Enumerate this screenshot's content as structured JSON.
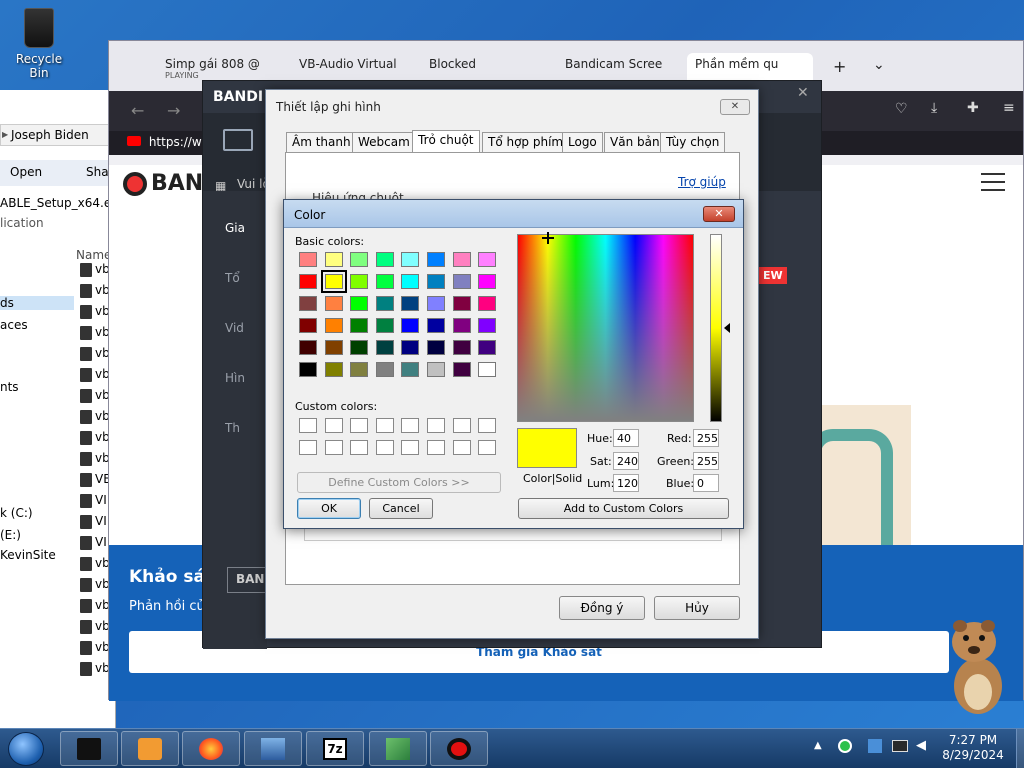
{
  "desktop": {
    "recycle_bin": "Recycle Bin"
  },
  "explorer": {
    "address": "Joseph Biden",
    "address_sep": "▶",
    "open": "Open",
    "share": "Sha",
    "file_title": "ABLE_Setup_x64.ex",
    "file_sub": "lication",
    "nav": [
      "ds",
      "aces",
      "nts",
      "k (C:)",
      "(E:)",
      "KevinSite"
    ],
    "column_name": "Name",
    "file_rows": [
      "vb",
      "vb",
      "vb",
      "vb",
      "vb",
      "vb",
      "vb",
      "vb",
      "vb",
      "vb",
      "VB",
      "VI",
      "VI",
      "VI",
      "vb",
      "vb",
      "vb",
      "vb",
      "vb",
      "vb"
    ]
  },
  "browser": {
    "tabs": [
      {
        "label": "Simp gái 808 @",
        "sub": "PLAYING"
      },
      {
        "label": "VB-Audio Virtual"
      },
      {
        "label": "Blocked"
      },
      {
        "label": "Bandicam Scree"
      },
      {
        "label": "Phần mềm qu"
      }
    ],
    "new_tab": "+",
    "tab_list": "⌄",
    "url": "https://ww",
    "survey_heading": "Khảo sát",
    "survey_text": "Phản hồi củ",
    "survey_button": "Tham gia Khảo sát"
  },
  "bandicam": {
    "logo": "BANDI",
    "header_text": "Vui lò",
    "site_logo": "BAN",
    "sidebar": [
      "Gia",
      "Tổ",
      "Vid",
      "Hìn",
      "Th"
    ],
    "new_badge": "EW",
    "footer_logo": "BAN",
    "close": "✕"
  },
  "settings": {
    "title": "Thiết lập ghi hình",
    "close": "✕",
    "tabs": [
      "Âm thanh",
      "Webcam",
      "Trỏ chuột",
      "Tổ hợp phím",
      "Logo",
      "Văn bản",
      "Tùy chọn"
    ],
    "active_tab": "Trỏ chuột",
    "help": "Trợ giúp",
    "section": "Hiệu ứng chuột",
    "ok": "Đồng ý",
    "cancel": "Hủy"
  },
  "color_dialog": {
    "title": "Color",
    "close": "✕",
    "basic_colors_label": "Basic colors:",
    "custom_colors_label": "Custom colors:",
    "basic_colors": [
      "#ff8080",
      "#ffff80",
      "#80ff80",
      "#00ff80",
      "#80ffff",
      "#0080ff",
      "#ff80c0",
      "#ff80ff",
      "#ff0000",
      "#ffff00",
      "#80ff00",
      "#00ff40",
      "#00ffff",
      "#0080c0",
      "#8080c0",
      "#ff00ff",
      "#804040",
      "#ff8040",
      "#00ff00",
      "#008080",
      "#004080",
      "#8080ff",
      "#800040",
      "#ff0080",
      "#800000",
      "#ff8000",
      "#008000",
      "#008040",
      "#0000ff",
      "#0000a0",
      "#800080",
      "#8000ff",
      "#400000",
      "#804000",
      "#004000",
      "#004040",
      "#000080",
      "#000040",
      "#400040",
      "#400080",
      "#000000",
      "#808000",
      "#808040",
      "#808080",
      "#408080",
      "#c0c0c0",
      "#400040",
      "#ffffff"
    ],
    "selected_index": 9,
    "custom_colors": [
      "#ffffff",
      "#ffffff",
      "#ffffff",
      "#ffffff",
      "#ffffff",
      "#ffffff",
      "#ffffff",
      "#ffffff",
      "#ffffff",
      "#ffffff",
      "#ffffff",
      "#ffffff",
      "#ffffff",
      "#ffffff",
      "#ffffff",
      "#ffffff"
    ],
    "define_custom": "Define Custom Colors >>",
    "ok": "OK",
    "cancel": "Cancel",
    "color_solid_label": "Color|Solid",
    "current_color": "#ffff00",
    "hue_label": "Hue:",
    "hue": "40",
    "sat_label": "Sat:",
    "sat": "240",
    "lum_label": "Lum:",
    "lum": "120",
    "red_label": "Red:",
    "red": "255",
    "green_label": "Green:",
    "green": "255",
    "blue_label": "Blue:",
    "blue": "0",
    "add_custom": "Add to Custom Colors"
  },
  "taskbar": {
    "time": "7:27 PM",
    "date": "8/29/2024",
    "items": [
      "terminal-icon",
      "media-player-icon",
      "firefox-icon",
      "installer-icon",
      "7zip-icon",
      "app-icon",
      "bandicam-record-icon"
    ],
    "sevenzip": "7z"
  }
}
